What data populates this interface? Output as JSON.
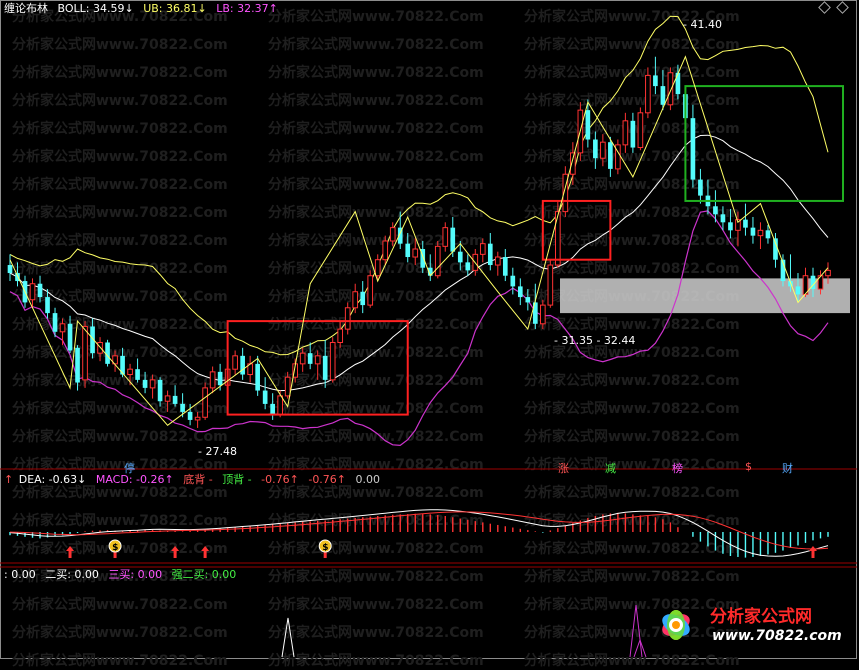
{
  "legend_top": {
    "name": "缠论布林",
    "boll": "BOLL: 34.59↓",
    "ub": "UB: 36.81↓",
    "lb": "LB: 32.37↑",
    "colors": {
      "name": "#ffffff",
      "boll": "#ffffff",
      "ub": "#ffff66",
      "lb": "#ff55ff"
    }
  },
  "legend_macd": {
    "lead": "↑",
    "dea": "DEA: -0.63↓",
    "macd": "MACD: -0.26↑",
    "bottom_div": "底背 -",
    "top_div": "顶背 -",
    "v1": "-0.76↑",
    "v2": "-0.76↑",
    "v3": "0.00"
  },
  "legend_buy": {
    "first": ": 0.00",
    "second": "二买: 0.00",
    "third": "三买: 0.00",
    "strong": "强二买: 0.00"
  },
  "annotations": {
    "high": "41.40",
    "low": "27.48",
    "mid": "31.35 - 32.44"
  },
  "event_tags": [
    {
      "text": "停",
      "color": "#55aaff"
    },
    {
      "text": "涨",
      "color": "#ff5555"
    },
    {
      "text": "减",
      "color": "#44ee44"
    },
    {
      "text": "榜",
      "color": "#ff55ff"
    },
    {
      "text": "$",
      "color": "#ff5555"
    },
    {
      "text": "财",
      "color": "#55aaff"
    }
  ],
  "watermark": "分析家公式网www.70822.Com",
  "logo": {
    "text": "分析家公式网",
    "url": "www.70822.com"
  },
  "colors": {
    "up": "#ff3333",
    "down": "#54fcfc",
    "ma": "#ffffff",
    "upper": "#ffff66",
    "lower": "#cc33cc",
    "box_red": "#ff2020",
    "box_green": "#20b020",
    "band": "#cfcfcf",
    "axis": "#9b0000",
    "dif": "#ffffff",
    "dea": "#ffff00",
    "hist_up": "#ff3333",
    "hist_down": "#54fcfc"
  },
  "chart_data": {
    "type": "candlestick",
    "price_range": [
      26,
      43
    ],
    "candles": [
      [
        33.6,
        34.0,
        33.0,
        33.3
      ],
      [
        33.3,
        33.7,
        32.8,
        33.0
      ],
      [
        33.0,
        33.2,
        32.0,
        32.2
      ],
      [
        32.3,
        33.1,
        32.0,
        32.9
      ],
      [
        32.9,
        33.2,
        32.2,
        32.4
      ],
      [
        32.4,
        32.7,
        31.6,
        31.8
      ],
      [
        31.8,
        32.0,
        30.9,
        31.1
      ],
      [
        31.1,
        31.6,
        30.6,
        31.4
      ],
      [
        31.4,
        31.7,
        30.3,
        30.4
      ],
      [
        30.5,
        30.6,
        28.9,
        29.2
      ],
      [
        29.3,
        31.5,
        29.0,
        31.3
      ],
      [
        31.3,
        31.6,
        30.1,
        30.3
      ],
      [
        30.3,
        30.9,
        30.0,
        30.7
      ],
      [
        30.7,
        30.8,
        29.8,
        29.9
      ],
      [
        29.9,
        30.4,
        29.6,
        30.2
      ],
      [
        30.2,
        30.5,
        29.4,
        29.5
      ],
      [
        29.5,
        29.9,
        29.1,
        29.7
      ],
      [
        29.7,
        30.1,
        29.2,
        29.3
      ],
      [
        29.3,
        29.6,
        28.8,
        29.0
      ],
      [
        29.0,
        29.5,
        28.6,
        29.3
      ],
      [
        29.3,
        29.4,
        28.3,
        28.5
      ],
      [
        28.5,
        28.9,
        28.1,
        28.7
      ],
      [
        28.7,
        29.1,
        28.3,
        28.4
      ],
      [
        28.4,
        28.8,
        27.9,
        28.1
      ],
      [
        28.1,
        28.4,
        27.6,
        27.8
      ],
      [
        27.8,
        28.1,
        27.5,
        27.9
      ],
      [
        27.9,
        29.2,
        27.8,
        29.0
      ],
      [
        29.0,
        29.8,
        28.8,
        29.6
      ],
      [
        29.6,
        29.9,
        28.9,
        29.1
      ],
      [
        29.1,
        29.9,
        28.9,
        29.7
      ],
      [
        29.7,
        30.4,
        29.5,
        30.2
      ],
      [
        30.2,
        30.5,
        29.3,
        29.5
      ],
      [
        29.5,
        30.2,
        29.2,
        29.9
      ],
      [
        29.9,
        30.2,
        28.7,
        28.9
      ],
      [
        28.9,
        29.4,
        28.2,
        28.4
      ],
      [
        28.4,
        28.8,
        27.8,
        28.0
      ],
      [
        28.0,
        28.9,
        27.9,
        28.7
      ],
      [
        28.7,
        29.6,
        28.6,
        29.4
      ],
      [
        29.4,
        30.1,
        29.2,
        29.9
      ],
      [
        29.9,
        30.5,
        29.6,
        30.3
      ],
      [
        30.3,
        30.7,
        29.7,
        29.9
      ],
      [
        29.9,
        30.4,
        29.3,
        30.2
      ],
      [
        30.2,
        30.8,
        29.0,
        29.3
      ],
      [
        29.3,
        30.9,
        29.2,
        30.7
      ],
      [
        30.7,
        31.5,
        30.5,
        31.2
      ],
      [
        31.2,
        32.2,
        31.0,
        32.0
      ],
      [
        32.0,
        32.9,
        31.8,
        32.6
      ],
      [
        32.6,
        33.0,
        31.8,
        32.1
      ],
      [
        32.1,
        33.4,
        32.0,
        33.2
      ],
      [
        33.2,
        34.0,
        33.0,
        33.8
      ],
      [
        33.8,
        34.7,
        33.6,
        34.5
      ],
      [
        34.5,
        35.2,
        34.3,
        35.0
      ],
      [
        35.0,
        35.6,
        34.2,
        34.4
      ],
      [
        34.4,
        34.8,
        33.7,
        33.9
      ],
      [
        33.9,
        34.6,
        33.6,
        34.2
      ],
      [
        34.2,
        34.5,
        33.3,
        33.5
      ],
      [
        33.5,
        34.0,
        33.0,
        33.2
      ],
      [
        33.2,
        34.5,
        33.1,
        34.3
      ],
      [
        34.3,
        35.2,
        34.1,
        35.0
      ],
      [
        35.0,
        35.4,
        33.9,
        34.1
      ],
      [
        34.1,
        34.5,
        33.4,
        33.7
      ],
      [
        33.7,
        34.0,
        33.2,
        33.4
      ],
      [
        33.4,
        34.2,
        33.2,
        34.0
      ],
      [
        34.0,
        34.6,
        33.7,
        34.4
      ],
      [
        34.4,
        34.8,
        33.4,
        33.6
      ],
      [
        33.6,
        34.1,
        33.2,
        33.9
      ],
      [
        33.9,
        34.2,
        33.0,
        33.2
      ],
      [
        33.2,
        33.5,
        32.5,
        32.8
      ],
      [
        32.8,
        33.1,
        32.1,
        32.4
      ],
      [
        32.4,
        32.7,
        31.9,
        32.2
      ],
      [
        32.2,
        32.9,
        31.2,
        31.4
      ],
      [
        31.4,
        32.3,
        31.2,
        32.1
      ],
      [
        32.1,
        33.8,
        32.0,
        33.6
      ],
      [
        33.6,
        36.0,
        33.5,
        35.6
      ],
      [
        35.6,
        37.3,
        35.4,
        37.0
      ],
      [
        37.0,
        38.2,
        36.6,
        37.8
      ],
      [
        37.8,
        39.7,
        37.5,
        39.4
      ],
      [
        39.4,
        39.8,
        38.0,
        38.3
      ],
      [
        38.3,
        38.6,
        37.2,
        37.6
      ],
      [
        37.6,
        38.5,
        37.3,
        38.2
      ],
      [
        38.2,
        38.4,
        36.9,
        37.2
      ],
      [
        37.2,
        38.3,
        37.0,
        38.1
      ],
      [
        38.1,
        39.3,
        37.8,
        39.0
      ],
      [
        39.0,
        39.3,
        37.8,
        38.0
      ],
      [
        38.0,
        39.5,
        37.9,
        39.3
      ],
      [
        39.3,
        41.0,
        39.1,
        40.7
      ],
      [
        40.7,
        41.4,
        40.0,
        40.3
      ],
      [
        40.3,
        40.9,
        39.4,
        39.6
      ],
      [
        39.6,
        41.0,
        39.4,
        40.8
      ],
      [
        40.8,
        41.1,
        39.8,
        40.0
      ],
      [
        40.0,
        40.3,
        38.8,
        39.1
      ],
      [
        39.1,
        39.6,
        36.5,
        36.8
      ],
      [
        36.8,
        37.2,
        35.9,
        36.2
      ],
      [
        36.2,
        36.8,
        35.5,
        35.8
      ],
      [
        35.8,
        36.4,
        35.2,
        35.5
      ],
      [
        35.5,
        35.8,
        34.9,
        35.2
      ],
      [
        35.2,
        35.7,
        34.6,
        34.9
      ],
      [
        34.9,
        35.6,
        34.3,
        35.3
      ],
      [
        35.3,
        35.9,
        34.7,
        35.0
      ],
      [
        35.0,
        35.4,
        34.4,
        34.7
      ],
      [
        34.7,
        35.2,
        34.2,
        34.9
      ],
      [
        34.9,
        35.1,
        34.4,
        34.6
      ],
      [
        34.6,
        34.8,
        33.5,
        33.8
      ],
      [
        33.8,
        34.0,
        32.8,
        33.0
      ],
      [
        33.0,
        34.0,
        32.6,
        32.8
      ],
      [
        32.8,
        33.3,
        32.2,
        32.5
      ],
      [
        32.5,
        33.5,
        32.4,
        33.2
      ],
      [
        33.2,
        33.5,
        32.4,
        32.7
      ],
      [
        32.7,
        33.4,
        32.5,
        33.2
      ],
      [
        33.2,
        33.7,
        32.9,
        33.4
      ]
    ],
    "macd_hist": [
      -0.1,
      -0.12,
      -0.15,
      -0.18,
      -0.2,
      -0.17,
      -0.14,
      -0.1,
      -0.06,
      -0.03,
      0.02,
      0.04,
      0.05,
      0.06,
      0.04,
      0.03,
      0.05,
      0.06,
      0.08,
      0.07,
      0.05,
      0.04,
      0.03,
      0.02,
      0.04,
      0.06,
      0.08,
      0.1,
      0.12,
      0.14,
      0.15,
      0.17,
      0.18,
      0.2,
      0.22,
      0.24,
      0.26,
      0.28,
      0.3,
      0.32,
      0.33,
      0.35,
      0.36,
      0.38,
      0.4,
      0.42,
      0.44,
      0.46,
      0.48,
      0.5,
      0.52,
      0.54,
      0.55,
      0.56,
      0.57,
      0.56,
      0.55,
      0.53,
      0.5,
      0.46,
      0.42,
      0.38,
      0.34,
      0.3,
      0.26,
      0.22,
      0.18,
      0.14,
      0.1,
      0.06,
      0.02,
      -0.02,
      0.05,
      0.12,
      0.2,
      0.28,
      0.36,
      0.44,
      0.5,
      0.55,
      0.58,
      0.6,
      0.58,
      0.55,
      0.52,
      0.5,
      0.46,
      0.4,
      0.3,
      0.15,
      0.0,
      -0.15,
      -0.3,
      -0.45,
      -0.58,
      -0.68,
      -0.75,
      -0.78,
      -0.8,
      -0.78,
      -0.75,
      -0.7,
      -0.65,
      -0.58,
      -0.5,
      -0.42,
      -0.34,
      -0.26,
      -0.2,
      -0.15
    ],
    "buy_signals": [
      8,
      14,
      22,
      26,
      42,
      107
    ],
    "dollar_signals": [
      14,
      42
    ]
  }
}
